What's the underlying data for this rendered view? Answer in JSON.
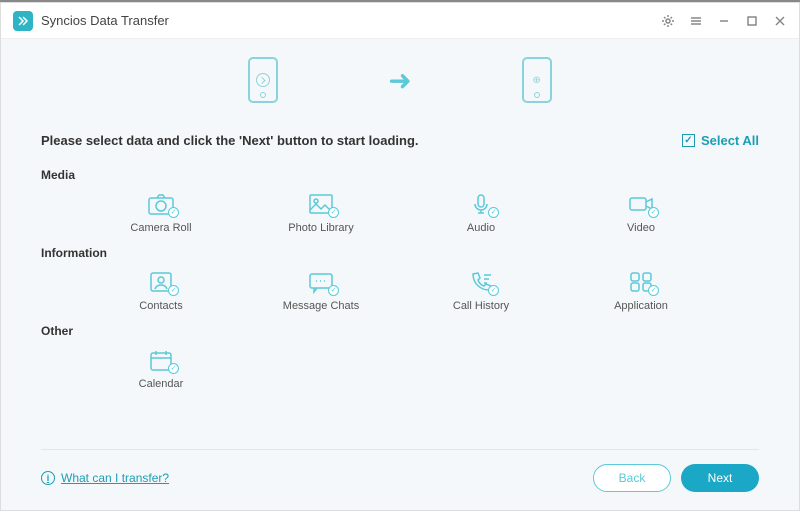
{
  "app": {
    "title": "Syncios Data Transfer"
  },
  "instruction": "Please select data and click the 'Next' button to start loading.",
  "select_all_label": "Select All",
  "sections": {
    "media": {
      "title": "Media",
      "items": [
        {
          "label": "Camera Roll"
        },
        {
          "label": "Photo Library"
        },
        {
          "label": "Audio"
        },
        {
          "label": "Video"
        }
      ]
    },
    "information": {
      "title": "Information",
      "items": [
        {
          "label": "Contacts"
        },
        {
          "label": "Message Chats"
        },
        {
          "label": "Call History"
        },
        {
          "label": "Application"
        }
      ]
    },
    "other": {
      "title": "Other",
      "items": [
        {
          "label": "Calendar"
        }
      ]
    }
  },
  "footer": {
    "help_text": "What can I transfer?",
    "back_label": "Back",
    "next_label": "Next"
  }
}
